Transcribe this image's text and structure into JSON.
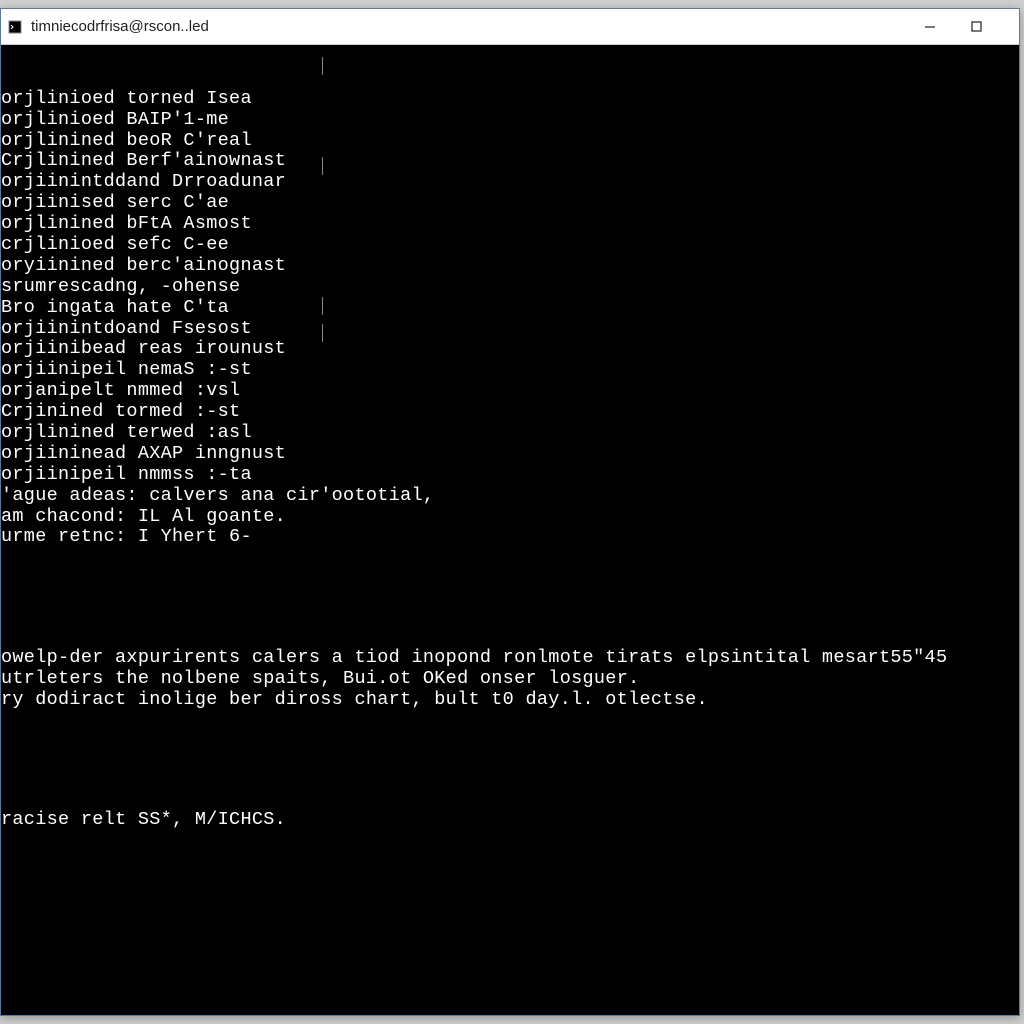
{
  "window": {
    "title": "timniecodrfrisa@rscon..led"
  },
  "terminal": {
    "lines": [
      "orjlinioed torned Isea",
      "orjlinioed BAIP'1-me",
      "orjlinined beoR C'real",
      "Crjlinined Berf'ainownast",
      "orjiinintddand Drroadunar",
      "orjiinised serc C'ae",
      "orjlinined bFtA Asmost",
      "crjlinioed sefc C-ee",
      "oryiinined berc'ainognast",
      "srumrescadng, -ohense",
      "Bro ingata hate C'ta",
      "orjiinintdoand Fsesost",
      "orjiinibead reas irounust",
      "orjiinipeil nemaS :-st",
      "orjanipelt nmmed :vsl",
      "Crjinined tormed :-st",
      "orjlinined terwed :asl",
      "orjiininead AXAP inngnust",
      "orjiinipeil nmmss :-ta",
      "'ague adeas: calvers ana cir'oototial,",
      "am chacond: IL Al goante.",
      "urme retnc: I Yhert 6-"
    ],
    "paragraph": [
      "owelp-der axpurirents calers a tiod inopond ronlmote tirats elpsintital mesart55\"45",
      "utrleters the nolbene spaits, Bui.ot OKed onser losguer.",
      "ry dodiract inolige ber diross chart, bult t0 day.l. otlectse."
    ],
    "footer": "racise relt SS*, M/ICHCS."
  }
}
